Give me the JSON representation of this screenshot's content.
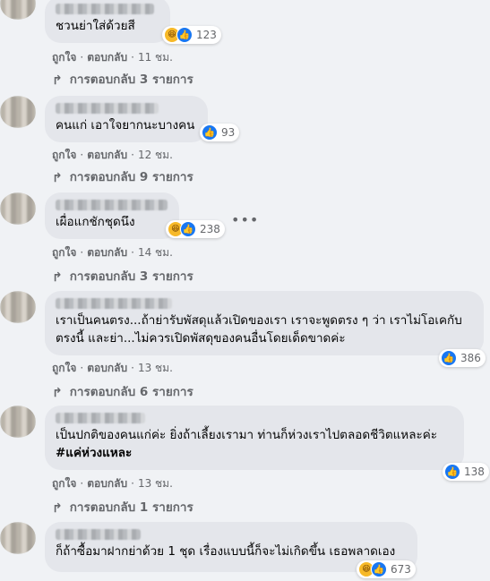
{
  "comments": [
    {
      "text": "ชวนย่าใส่ด้วยสี",
      "reaction_count": "123",
      "reactions": [
        "haha",
        "like"
      ],
      "like_label": "ถูกใจ",
      "reply_label": "ตอบกลับ",
      "time": "11 ชม.",
      "replies": "การตอบกลับ 3 รายการ"
    },
    {
      "text": "คนแก่ เอาใจยากนะบางคน",
      "reaction_count": "93",
      "reactions": [
        "like"
      ],
      "like_label": "ถูกใจ",
      "reply_label": "ตอบกลับ",
      "time": "12 ชม.",
      "replies": "การตอบกลับ 9 รายการ"
    },
    {
      "text": "เผื่อแกชักชุดนึง",
      "reaction_count": "238",
      "reactions": [
        "haha",
        "like"
      ],
      "like_label": "ถูกใจ",
      "reply_label": "ตอบกลับ",
      "time": "14 ชม.",
      "replies": "การตอบกลับ 3 รายการ",
      "more": "•••"
    },
    {
      "line1": "เราเป็นคนตรง...ถ้าย่ารับพัสดุแล้วเปิดของเรา เราจะพูดตรง ๆ ว่า เราไม่โอเคกับ",
      "line2": "ตรงนี้ และย่า...ไม่ควรเปิดพัสดุของคนอื่นโดยเด็ดขาดค่ะ",
      "reaction_count": "386",
      "reactions": [
        "like"
      ],
      "like_label": "ถูกใจ",
      "reply_label": "ตอบกลับ",
      "time": "13 ชม.",
      "replies": "การตอบกลับ 6 รายการ"
    },
    {
      "line1": "เป็นปกติของคนแก่ค่ะ ยิ่งถ้าเลี้ยงเรามา ท่านก็ห่วงเราไปตลอดชีวิตแหละค่ะ",
      "hashtag": "#แค่ห่วงแหละ",
      "reaction_count": "138",
      "reactions": [
        "like"
      ],
      "like_label": "ถูกใจ",
      "reply_label": "ตอบกลับ",
      "time": "13 ชม.",
      "replies": "การตอบกลับ 1 รายการ"
    },
    {
      "text": "ก็ถ้าซื้อมาฝากย่าด้วย 1 ชุด เรื่องแบบนี้ก็จะไม่เกิดขึ้น เธอพลาดเอง",
      "reaction_count": "673",
      "reactions": [
        "haha",
        "like"
      ]
    }
  ],
  "icons": {
    "like": "👍",
    "haha": "😆",
    "reply_arrow": "↳"
  }
}
